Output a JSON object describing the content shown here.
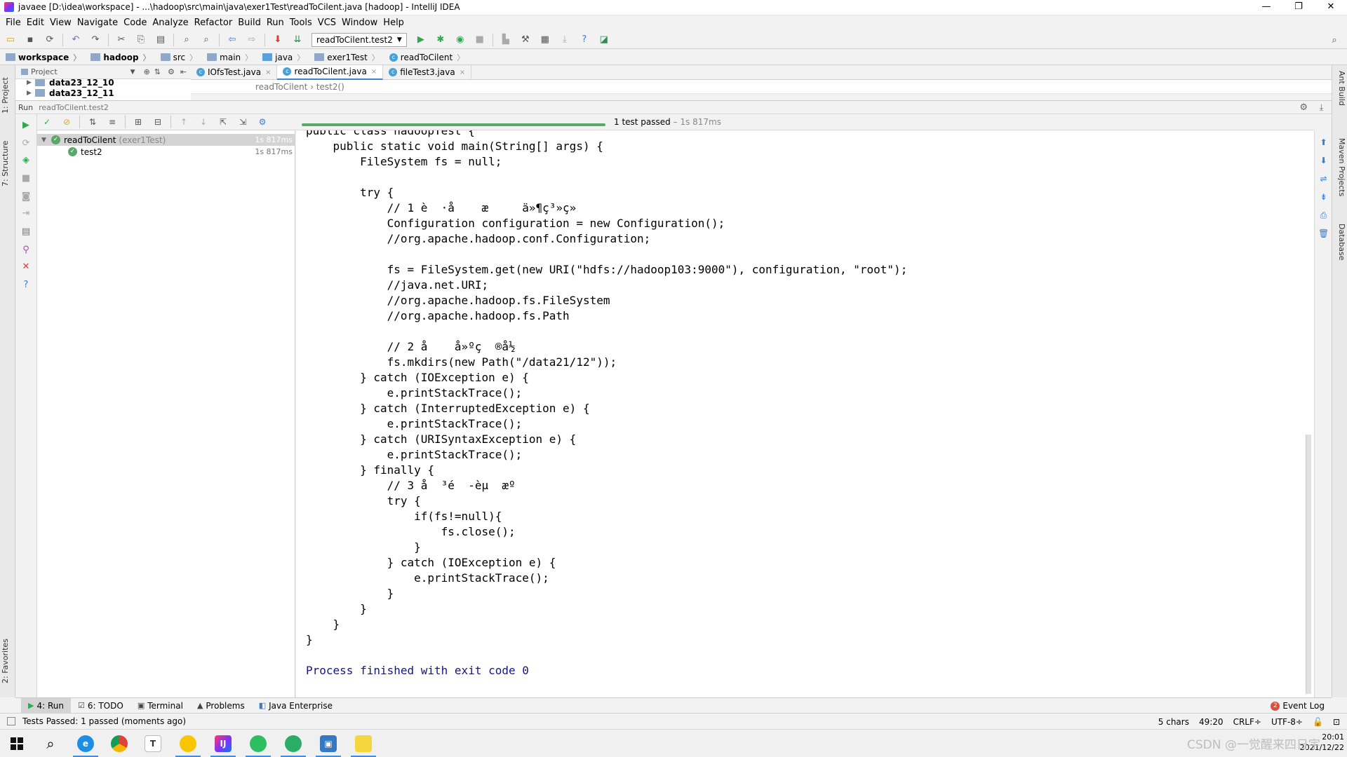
{
  "window": {
    "title": "javaee [D:\\idea\\workspace] - ...\\hadoop\\src\\main\\java\\exer1Test\\readToCilent.java [hadoop] - IntelliJ IDEA",
    "controls": [
      "—",
      "❐",
      "✕"
    ]
  },
  "menu": [
    "File",
    "Edit",
    "View",
    "Navigate",
    "Code",
    "Analyze",
    "Refactor",
    "Build",
    "Run",
    "Tools",
    "VCS",
    "Window",
    "Help"
  ],
  "toolbar": {
    "run_config": "readToCilent.test2"
  },
  "breadcrumb": [
    "workspace",
    "hadoop",
    "src",
    "main",
    "java",
    "exer1Test",
    "readToCilent"
  ],
  "project_panel": {
    "title": "Project",
    "nodes": [
      "data23_12_10",
      "data23_12_11"
    ]
  },
  "editor": {
    "tabs": [
      {
        "label": "IOfsTest.java",
        "active": false
      },
      {
        "label": "readToCilent.java",
        "active": true
      },
      {
        "label": "fileTest3.java",
        "active": false
      }
    ],
    "breadcrumb": "readToCilent  ›  test2()"
  },
  "run_panel": {
    "label": "Run",
    "config": "readToCilent.test2",
    "status": "1 test passed",
    "status_time": "– 1s 817ms",
    "tree": [
      {
        "name": "readToCilent",
        "suffix": "(exer1Test)",
        "duration": "1s 817ms",
        "selected": true
      },
      {
        "name": "test2",
        "suffix": "",
        "duration": "1s 817ms",
        "selected": false
      }
    ],
    "progress": 1.0
  },
  "console": {
    "code": "public class hadoopTest {\n    public static void main(String[] args) {\n        FileSystem fs = null;\n\n        try {\n            // 1 è  ·å    æ     ä»¶ç³»ç»\n            Configuration configuration = new Configuration();\n            //org.apache.hadoop.conf.Configuration;\n\n            fs = FileSystem.get(new URI(\"hdfs://hadoop103:9000\"), configuration, \"root\");\n            //java.net.URI;\n            //org.apache.hadoop.fs.FileSystem\n            //org.apache.hadoop.fs.Path\n\n            // 2 å    å»ºç  ®å½\n            fs.mkdirs(new Path(\"/data21/12\"));\n        } catch (IOException e) {\n            e.printStackTrace();\n        } catch (InterruptedException e) {\n            e.printStackTrace();\n        } catch (URISyntaxException e) {\n            e.printStackTrace();\n        } finally {\n            // 3 å  ³é  -èµ  æº\n            try {\n                if(fs!=null){\n                    fs.close();\n                }\n            } catch (IOException e) {\n                e.printStackTrace();\n            }\n        }\n    }\n}\n",
    "exit_line": "Process finished with exit code 0"
  },
  "bottom_tabs": [
    {
      "icon": "▶",
      "label": "4: Run",
      "active": true
    },
    {
      "icon": "☑",
      "label": "6: TODO",
      "active": false
    },
    {
      "icon": "▣",
      "label": "Terminal",
      "active": false
    },
    {
      "icon": "▲",
      "label": "Problems",
      "active": false
    },
    {
      "icon": "◧",
      "label": "Java Enterprise",
      "active": false
    }
  ],
  "event_log": {
    "badge": "2",
    "label": "Event Log"
  },
  "status_bar": {
    "message": "Tests Passed: 1 passed (moments ago)",
    "chars": "5 chars",
    "position": "49:20",
    "line_sep": "CRLF÷",
    "encoding": "UTF-8÷"
  },
  "side_tabs": {
    "left": [
      "1: Project",
      "7: Structure",
      "2: Favorites"
    ],
    "right": [
      "Ant Build",
      "Maven Projects",
      "Database"
    ]
  },
  "taskbar": {
    "clock_time": "20:01",
    "clock_date": "2021/12/22",
    "watermark": "CSDN @一觉醒来四日宇"
  },
  "colors": {
    "accent": "#4083c9",
    "pass_green": "#59a869",
    "exit_blue": "#14148c"
  }
}
